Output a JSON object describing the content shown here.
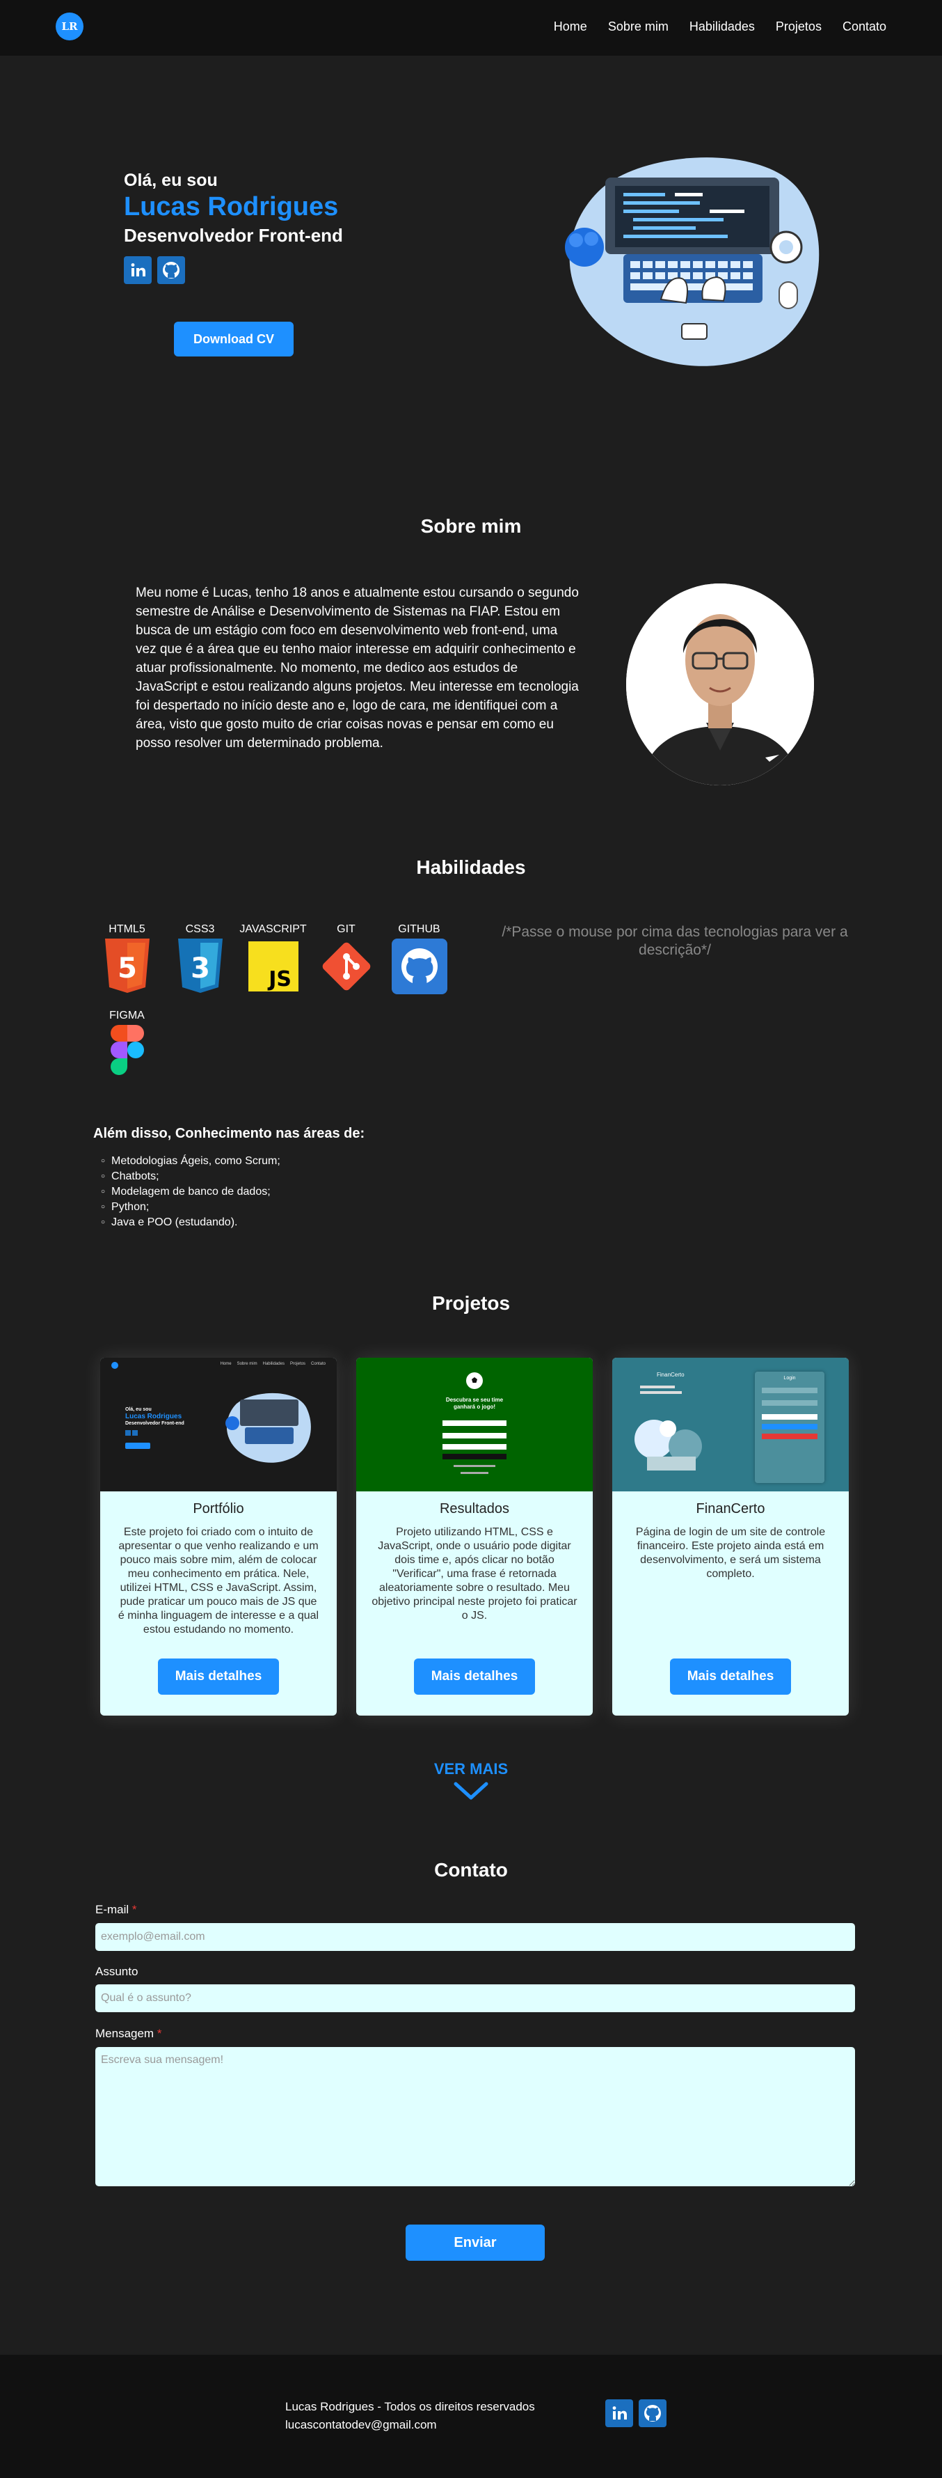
{
  "nav": {
    "logo": "LR",
    "links": [
      "Home",
      "Sobre mim",
      "Habilidades",
      "Projetos",
      "Contato"
    ]
  },
  "hero": {
    "greeting": "Olá, eu sou",
    "name": "Lucas Rodrigues",
    "role": "Desenvolvedor Front-end",
    "cv_button": "Download CV",
    "social": [
      "linkedin-icon",
      "github-icon"
    ]
  },
  "about": {
    "title": "Sobre mim",
    "text": "Meu nome é Lucas, tenho 18 anos e atualmente estou cursando o segundo semestre de Análise e Desenvolvimento de Sistemas na FIAP. Estou em busca de um estágio com foco em desenvolvimento web front-end, uma vez que é a área que eu tenho maior interesse em adquirir conhecimento e atuar profissionalmente. No momento, me dedico aos estudos de JavaScript e estou realizando alguns projetos. Meu interesse em tecnologia foi despertado no início deste ano e, logo de cara, me identifiquei com a área, visto que gosto muito de criar coisas novas e pensar em como eu posso resolver um determinado problema."
  },
  "skills": {
    "title": "Habilidades",
    "items": [
      "HTML5",
      "CSS3",
      "JAVASCRIPT",
      "GIT",
      "GITHUB",
      "FIGMA"
    ],
    "hint": "/*Passe o mouse por cima das tecnologias para ver a descrição*/",
    "knowledge_title": "Além disso, Conhecimento nas áreas de:",
    "knowledge": [
      "Metodologias Ágeis, como Scrum;",
      "Chatbots;",
      "Modelagem de banco de dados;",
      "Python;",
      "Java e POO (estudando)."
    ]
  },
  "projects": {
    "title": "Projetos",
    "items": [
      {
        "title": "Portfólio",
        "desc": "Este projeto foi criado com o intuito de apresentar o que venho realizando e um pouco mais sobre mim, além de colocar meu conhecimento em prática. Nele, utilizei HTML, CSS e JavaScript. Assim, pude praticar um pouco mais de JS que é minha linguagem de interesse e a qual estou estudando no momento.",
        "button": "Mais detalhes",
        "thumb": {
          "nav": [
            "Home",
            "Sobre mim",
            "Habilidades",
            "Projetos",
            "Contato"
          ],
          "greeting": "Olá, eu sou",
          "name": "Lucas Rodrigues",
          "role": "Desenvolvedor Front-end"
        }
      },
      {
        "title": "Resultados",
        "desc": "Projeto utilizando HTML, CSS e JavaScript, onde o usuário pode digitar dois time e, após clicar no botão \"Verificar\", uma frase é retornada aleatoriamente sobre o resultado. Meu objetivo principal neste projeto foi praticar o JS.",
        "button": "Mais detalhes",
        "thumb": {
          "heading": "Descubra se seu time ganhará o jogo!"
        }
      },
      {
        "title": "FinanCerto",
        "desc": "Página de login de um site de controle financeiro. Este projeto ainda está em desenvolvimento, e será um sistema completo.",
        "button": "Mais detalhes",
        "thumb": {
          "brand": "FinanCerto",
          "login": "Login"
        }
      }
    ],
    "see_more": "VER MAIS"
  },
  "contact": {
    "title": "Contato",
    "email_label": "E-mail",
    "email_placeholder": "exemplo@email.com",
    "subject_label": "Assunto",
    "subject_placeholder": "Qual é o assunto?",
    "message_label": "Mensagem",
    "message_placeholder": "Escreva sua mensagem!",
    "required_mark": "*",
    "send": "Enviar"
  },
  "footer": {
    "rights": "Lucas Rodrigues - Todos os direitos reservados",
    "email": "lucascontatodev@gmail.com"
  },
  "colors": {
    "accent": "#1e90ff",
    "bg": "#1e1e1e",
    "nav": "#111111",
    "card": "#e0ffff"
  }
}
